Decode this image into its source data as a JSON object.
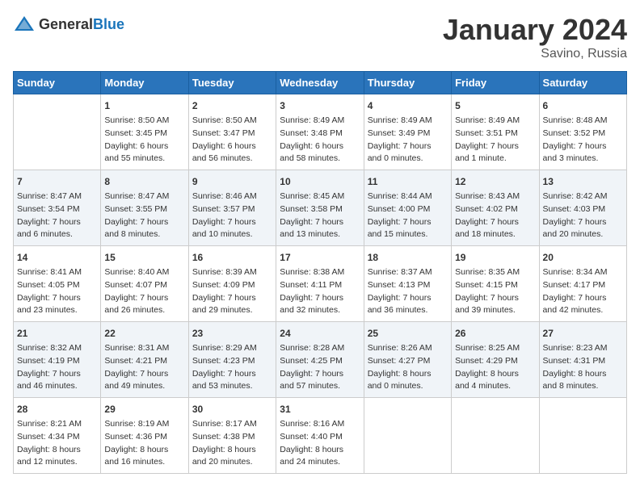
{
  "header": {
    "logo": {
      "general": "General",
      "blue": "Blue"
    },
    "month": "January 2024",
    "location": "Savino, Russia"
  },
  "columns": [
    "Sunday",
    "Monday",
    "Tuesday",
    "Wednesday",
    "Thursday",
    "Friday",
    "Saturday"
  ],
  "weeks": [
    [
      {
        "day": "",
        "content": ""
      },
      {
        "day": "1",
        "content": "Sunrise: 8:50 AM\nSunset: 3:45 PM\nDaylight: 6 hours\nand 55 minutes."
      },
      {
        "day": "2",
        "content": "Sunrise: 8:50 AM\nSunset: 3:47 PM\nDaylight: 6 hours\nand 56 minutes."
      },
      {
        "day": "3",
        "content": "Sunrise: 8:49 AM\nSunset: 3:48 PM\nDaylight: 6 hours\nand 58 minutes."
      },
      {
        "day": "4",
        "content": "Sunrise: 8:49 AM\nSunset: 3:49 PM\nDaylight: 7 hours\nand 0 minutes."
      },
      {
        "day": "5",
        "content": "Sunrise: 8:49 AM\nSunset: 3:51 PM\nDaylight: 7 hours\nand 1 minute."
      },
      {
        "day": "6",
        "content": "Sunrise: 8:48 AM\nSunset: 3:52 PM\nDaylight: 7 hours\nand 3 minutes."
      }
    ],
    [
      {
        "day": "7",
        "content": "Sunrise: 8:47 AM\nSunset: 3:54 PM\nDaylight: 7 hours\nand 6 minutes."
      },
      {
        "day": "8",
        "content": "Sunrise: 8:47 AM\nSunset: 3:55 PM\nDaylight: 7 hours\nand 8 minutes."
      },
      {
        "day": "9",
        "content": "Sunrise: 8:46 AM\nSunset: 3:57 PM\nDaylight: 7 hours\nand 10 minutes."
      },
      {
        "day": "10",
        "content": "Sunrise: 8:45 AM\nSunset: 3:58 PM\nDaylight: 7 hours\nand 13 minutes."
      },
      {
        "day": "11",
        "content": "Sunrise: 8:44 AM\nSunset: 4:00 PM\nDaylight: 7 hours\nand 15 minutes."
      },
      {
        "day": "12",
        "content": "Sunrise: 8:43 AM\nSunset: 4:02 PM\nDaylight: 7 hours\nand 18 minutes."
      },
      {
        "day": "13",
        "content": "Sunrise: 8:42 AM\nSunset: 4:03 PM\nDaylight: 7 hours\nand 20 minutes."
      }
    ],
    [
      {
        "day": "14",
        "content": "Sunrise: 8:41 AM\nSunset: 4:05 PM\nDaylight: 7 hours\nand 23 minutes."
      },
      {
        "day": "15",
        "content": "Sunrise: 8:40 AM\nSunset: 4:07 PM\nDaylight: 7 hours\nand 26 minutes."
      },
      {
        "day": "16",
        "content": "Sunrise: 8:39 AM\nSunset: 4:09 PM\nDaylight: 7 hours\nand 29 minutes."
      },
      {
        "day": "17",
        "content": "Sunrise: 8:38 AM\nSunset: 4:11 PM\nDaylight: 7 hours\nand 32 minutes."
      },
      {
        "day": "18",
        "content": "Sunrise: 8:37 AM\nSunset: 4:13 PM\nDaylight: 7 hours\nand 36 minutes."
      },
      {
        "day": "19",
        "content": "Sunrise: 8:35 AM\nSunset: 4:15 PM\nDaylight: 7 hours\nand 39 minutes."
      },
      {
        "day": "20",
        "content": "Sunrise: 8:34 AM\nSunset: 4:17 PM\nDaylight: 7 hours\nand 42 minutes."
      }
    ],
    [
      {
        "day": "21",
        "content": "Sunrise: 8:32 AM\nSunset: 4:19 PM\nDaylight: 7 hours\nand 46 minutes."
      },
      {
        "day": "22",
        "content": "Sunrise: 8:31 AM\nSunset: 4:21 PM\nDaylight: 7 hours\nand 49 minutes."
      },
      {
        "day": "23",
        "content": "Sunrise: 8:29 AM\nSunset: 4:23 PM\nDaylight: 7 hours\nand 53 minutes."
      },
      {
        "day": "24",
        "content": "Sunrise: 8:28 AM\nSunset: 4:25 PM\nDaylight: 7 hours\nand 57 minutes."
      },
      {
        "day": "25",
        "content": "Sunrise: 8:26 AM\nSunset: 4:27 PM\nDaylight: 8 hours\nand 0 minutes."
      },
      {
        "day": "26",
        "content": "Sunrise: 8:25 AM\nSunset: 4:29 PM\nDaylight: 8 hours\nand 4 minutes."
      },
      {
        "day": "27",
        "content": "Sunrise: 8:23 AM\nSunset: 4:31 PM\nDaylight: 8 hours\nand 8 minutes."
      }
    ],
    [
      {
        "day": "28",
        "content": "Sunrise: 8:21 AM\nSunset: 4:34 PM\nDaylight: 8 hours\nand 12 minutes."
      },
      {
        "day": "29",
        "content": "Sunrise: 8:19 AM\nSunset: 4:36 PM\nDaylight: 8 hours\nand 16 minutes."
      },
      {
        "day": "30",
        "content": "Sunrise: 8:17 AM\nSunset: 4:38 PM\nDaylight: 8 hours\nand 20 minutes."
      },
      {
        "day": "31",
        "content": "Sunrise: 8:16 AM\nSunset: 4:40 PM\nDaylight: 8 hours\nand 24 minutes."
      },
      {
        "day": "",
        "content": ""
      },
      {
        "day": "",
        "content": ""
      },
      {
        "day": "",
        "content": ""
      }
    ]
  ]
}
